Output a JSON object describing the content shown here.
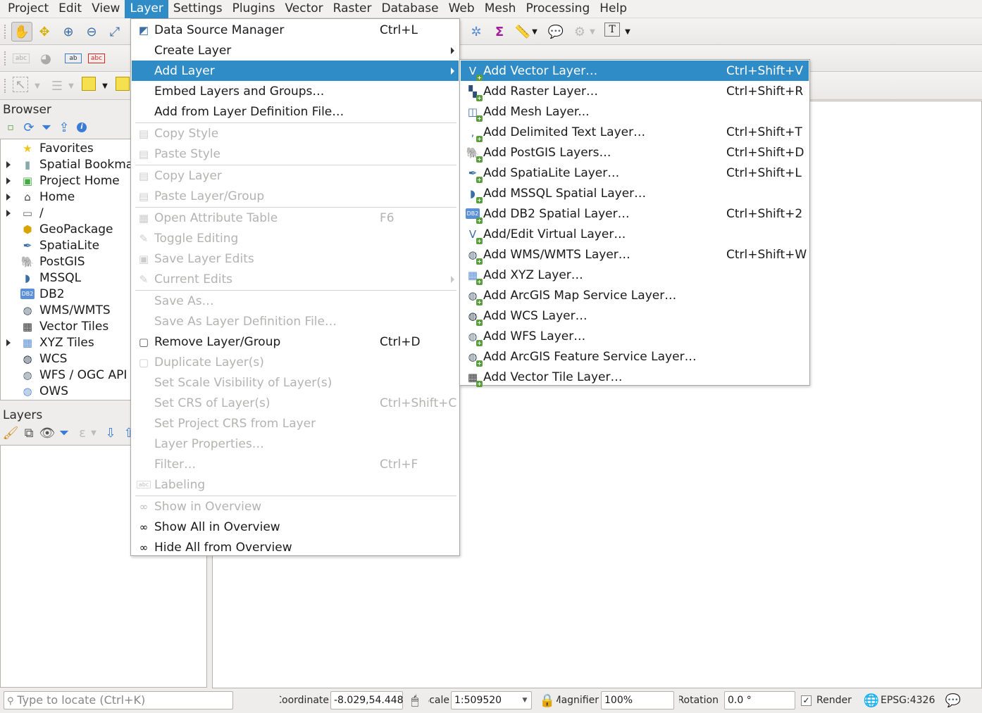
{
  "menubar": {
    "items": [
      {
        "label": "Project",
        "active": false
      },
      {
        "label": "Edit",
        "active": false
      },
      {
        "label": "View",
        "active": false
      },
      {
        "label": "Layer",
        "active": true
      },
      {
        "label": "Settings",
        "active": false
      },
      {
        "label": "Plugins",
        "active": false
      },
      {
        "label": "Vector",
        "active": false
      },
      {
        "label": "Raster",
        "active": false
      },
      {
        "label": "Database",
        "active": false
      },
      {
        "label": "Web",
        "active": false
      },
      {
        "label": "Mesh",
        "active": false
      },
      {
        "label": "Processing",
        "active": false
      },
      {
        "label": "Help",
        "active": false
      }
    ]
  },
  "toolbar": {
    "icons": [
      "pan-icon",
      "pan-to-selection-icon",
      "zoom-in-icon",
      "zoom-out-icon",
      "zoom-full-icon",
      "settings-gear-icon",
      "statistics-sigma-icon",
      "measure-icon",
      "annotation-icon",
      "identify-icon",
      "text-annotation-icon"
    ]
  },
  "browser": {
    "title": "Browser",
    "items": [
      {
        "label": "Favorites",
        "icon": "star-icon",
        "expandable": false
      },
      {
        "label": "Spatial Bookmarks",
        "icon": "bookmark-icon",
        "expandable": true
      },
      {
        "label": "Project Home",
        "icon": "project-home-icon",
        "expandable": true
      },
      {
        "label": "Home",
        "icon": "home-folder-icon",
        "expandable": true
      },
      {
        "label": "/",
        "icon": "folder-icon",
        "expandable": true
      },
      {
        "label": "GeoPackage",
        "icon": "geopackage-icon",
        "expandable": false
      },
      {
        "label": "SpatiaLite",
        "icon": "spatialite-icon",
        "expandable": false
      },
      {
        "label": "PostGIS",
        "icon": "postgis-icon",
        "expandable": false
      },
      {
        "label": "MSSQL",
        "icon": "mssql-icon",
        "expandable": false
      },
      {
        "label": "DB2",
        "icon": "db2-icon",
        "expandable": false
      },
      {
        "label": "WMS/WMTS",
        "icon": "wms-globe-icon",
        "expandable": false
      },
      {
        "label": "Vector Tiles",
        "icon": "vector-tiles-icon",
        "expandable": false
      },
      {
        "label": "XYZ Tiles",
        "icon": "xyz-tiles-icon",
        "expandable": true
      },
      {
        "label": "WCS",
        "icon": "wcs-globe-icon",
        "expandable": false
      },
      {
        "label": "WFS / OGC API - Features",
        "icon": "wfs-icon",
        "expandable": false
      },
      {
        "label": "OWS",
        "icon": "ows-globe-icon",
        "expandable": false
      }
    ]
  },
  "layers": {
    "title": "Layers"
  },
  "layer_menu": {
    "items": [
      {
        "label": "Data Source Manager",
        "shortcut": "Ctrl+L",
        "disabled": false,
        "icon": "data-source-manager-icon"
      },
      {
        "label": "Create Layer",
        "shortcut": "",
        "disabled": false,
        "submenu": true
      },
      {
        "label": "Add Layer",
        "shortcut": "",
        "disabled": false,
        "submenu": true,
        "highlight": true
      },
      {
        "label": "Embed Layers and Groups…",
        "shortcut": "",
        "disabled": false
      },
      {
        "label": "Add from Layer Definition File…",
        "shortcut": "",
        "disabled": false
      },
      {
        "separator": true
      },
      {
        "label": "Copy Style",
        "shortcut": "",
        "disabled": true,
        "icon": "copy-icon"
      },
      {
        "label": "Paste Style",
        "shortcut": "",
        "disabled": true,
        "icon": "paste-icon"
      },
      {
        "separator": true
      },
      {
        "label": "Copy Layer",
        "shortcut": "",
        "disabled": true,
        "icon": "copy-icon"
      },
      {
        "label": "Paste Layer/Group",
        "shortcut": "",
        "disabled": true,
        "icon": "paste-icon"
      },
      {
        "separator": true
      },
      {
        "label": "Open Attribute Table",
        "shortcut": "F6",
        "disabled": true,
        "icon": "table-icon"
      },
      {
        "label": "Toggle Editing",
        "shortcut": "",
        "disabled": true,
        "icon": "pencil-icon"
      },
      {
        "label": "Save Layer Edits",
        "shortcut": "",
        "disabled": true,
        "icon": "save-edits-icon"
      },
      {
        "label": "Current Edits",
        "shortcut": "",
        "disabled": true,
        "icon": "current-edits-icon",
        "submenu": true
      },
      {
        "separator": true
      },
      {
        "label": "Save As…",
        "shortcut": "",
        "disabled": true
      },
      {
        "label": "Save As Layer Definition File…",
        "shortcut": "",
        "disabled": true
      },
      {
        "label": "Remove Layer/Group",
        "shortcut": "Ctrl+D",
        "disabled": false,
        "icon": "remove-layer-icon"
      },
      {
        "label": "Duplicate Layer(s)",
        "shortcut": "",
        "disabled": true,
        "icon": "duplicate-icon"
      },
      {
        "label": "Set Scale Visibility of Layer(s)",
        "shortcut": "",
        "disabled": true
      },
      {
        "label": "Set CRS of Layer(s)",
        "shortcut": "Ctrl+Shift+C",
        "disabled": true
      },
      {
        "label": "Set Project CRS from Layer",
        "shortcut": "",
        "disabled": true
      },
      {
        "label": "Layer Properties…",
        "shortcut": "",
        "disabled": true
      },
      {
        "label": "Filter…",
        "shortcut": "Ctrl+F",
        "disabled": true
      },
      {
        "label": "Labeling",
        "shortcut": "",
        "disabled": true,
        "icon": "labeling-icon"
      },
      {
        "separator": true
      },
      {
        "label": "Show in Overview",
        "shortcut": "",
        "disabled": true,
        "icon": "overview-glasses-icon"
      },
      {
        "label": "Show All in Overview",
        "shortcut": "",
        "disabled": false,
        "icon": "show-all-overview-icon"
      },
      {
        "label": "Hide All from Overview",
        "shortcut": "",
        "disabled": false,
        "icon": "hide-all-overview-icon"
      }
    ]
  },
  "add_layer_submenu": {
    "items": [
      {
        "label": "Add Vector Layer…",
        "shortcut": "Ctrl+Shift+V",
        "icon": "vector-layer-icon",
        "highlight": true
      },
      {
        "label": "Add Raster Layer…",
        "shortcut": "Ctrl+Shift+R",
        "icon": "raster-layer-icon"
      },
      {
        "label": "Add Mesh Layer...",
        "shortcut": "",
        "icon": "mesh-layer-icon"
      },
      {
        "label": "Add Delimited Text Layer…",
        "shortcut": "Ctrl+Shift+T",
        "icon": "delimited-text-icon"
      },
      {
        "label": "Add PostGIS Layers…",
        "shortcut": "Ctrl+Shift+D",
        "icon": "postgis-icon"
      },
      {
        "label": "Add SpatiaLite Layer…",
        "shortcut": "Ctrl+Shift+L",
        "icon": "spatialite-icon"
      },
      {
        "label": "Add MSSQL Spatial Layer…",
        "shortcut": "",
        "icon": "mssql-icon"
      },
      {
        "label": "Add DB2 Spatial Layer…",
        "shortcut": "Ctrl+Shift+2",
        "icon": "db2-icon"
      },
      {
        "label": "Add/Edit Virtual Layer…",
        "shortcut": "",
        "icon": "virtual-layer-icon"
      },
      {
        "label": "Add WMS/WMTS Layer…",
        "shortcut": "Ctrl+Shift+W",
        "icon": "wms-icon"
      },
      {
        "label": "Add XYZ Layer…",
        "shortcut": "",
        "icon": "xyz-icon"
      },
      {
        "label": "Add ArcGIS Map Service Layer…",
        "shortcut": "",
        "icon": "arcgis-map-icon"
      },
      {
        "label": "Add WCS Layer…",
        "shortcut": "",
        "icon": "wcs-icon"
      },
      {
        "label": "Add WFS Layer…",
        "shortcut": "",
        "icon": "wfs-icon"
      },
      {
        "label": "Add ArcGIS Feature Service Layer…",
        "shortcut": "",
        "icon": "arcgis-feature-icon"
      },
      {
        "label": "Add Vector Tile Layer…",
        "shortcut": "",
        "icon": "vector-tile-icon"
      }
    ]
  },
  "statusbar": {
    "locator_placeholder": "Type to locate (Ctrl+K)",
    "coordinate_label": "Coordinate",
    "coordinate_value": "-8.029,54.448",
    "scale_label": "Scale",
    "scale_value": "1:509520",
    "magnifier_label": "Magnifier",
    "magnifier_value": "100%",
    "rotation_label": "Rotation",
    "rotation_value": "0.0 °",
    "render_label": "Render",
    "render_checked": true,
    "crs_label": "EPSG:4326"
  },
  "colors": {
    "highlight": "#308cc6",
    "disabled_text": "#b4b3b1"
  }
}
